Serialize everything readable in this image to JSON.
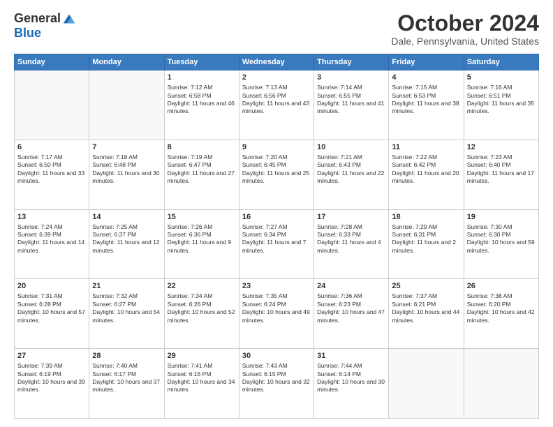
{
  "logo": {
    "general": "General",
    "blue": "Blue"
  },
  "title": "October 2024",
  "location": "Dale, Pennsylvania, United States",
  "days_of_week": [
    "Sunday",
    "Monday",
    "Tuesday",
    "Wednesday",
    "Thursday",
    "Friday",
    "Saturday"
  ],
  "weeks": [
    [
      {
        "day": "",
        "info": ""
      },
      {
        "day": "",
        "info": ""
      },
      {
        "day": "1",
        "info": "Sunrise: 7:12 AM\nSunset: 6:58 PM\nDaylight: 11 hours and 46 minutes."
      },
      {
        "day": "2",
        "info": "Sunrise: 7:13 AM\nSunset: 6:56 PM\nDaylight: 11 hours and 43 minutes."
      },
      {
        "day": "3",
        "info": "Sunrise: 7:14 AM\nSunset: 6:55 PM\nDaylight: 11 hours and 41 minutes."
      },
      {
        "day": "4",
        "info": "Sunrise: 7:15 AM\nSunset: 6:53 PM\nDaylight: 11 hours and 38 minutes."
      },
      {
        "day": "5",
        "info": "Sunrise: 7:16 AM\nSunset: 6:51 PM\nDaylight: 11 hours and 35 minutes."
      }
    ],
    [
      {
        "day": "6",
        "info": "Sunrise: 7:17 AM\nSunset: 6:50 PM\nDaylight: 11 hours and 33 minutes."
      },
      {
        "day": "7",
        "info": "Sunrise: 7:18 AM\nSunset: 6:48 PM\nDaylight: 11 hours and 30 minutes."
      },
      {
        "day": "8",
        "info": "Sunrise: 7:19 AM\nSunset: 6:47 PM\nDaylight: 11 hours and 27 minutes."
      },
      {
        "day": "9",
        "info": "Sunrise: 7:20 AM\nSunset: 6:45 PM\nDaylight: 11 hours and 25 minutes."
      },
      {
        "day": "10",
        "info": "Sunrise: 7:21 AM\nSunset: 6:43 PM\nDaylight: 11 hours and 22 minutes."
      },
      {
        "day": "11",
        "info": "Sunrise: 7:22 AM\nSunset: 6:42 PM\nDaylight: 11 hours and 20 minutes."
      },
      {
        "day": "12",
        "info": "Sunrise: 7:23 AM\nSunset: 6:40 PM\nDaylight: 11 hours and 17 minutes."
      }
    ],
    [
      {
        "day": "13",
        "info": "Sunrise: 7:24 AM\nSunset: 6:39 PM\nDaylight: 11 hours and 14 minutes."
      },
      {
        "day": "14",
        "info": "Sunrise: 7:25 AM\nSunset: 6:37 PM\nDaylight: 11 hours and 12 minutes."
      },
      {
        "day": "15",
        "info": "Sunrise: 7:26 AM\nSunset: 6:36 PM\nDaylight: 11 hours and 9 minutes."
      },
      {
        "day": "16",
        "info": "Sunrise: 7:27 AM\nSunset: 6:34 PM\nDaylight: 11 hours and 7 minutes."
      },
      {
        "day": "17",
        "info": "Sunrise: 7:28 AM\nSunset: 6:33 PM\nDaylight: 11 hours and 4 minutes."
      },
      {
        "day": "18",
        "info": "Sunrise: 7:29 AM\nSunset: 6:31 PM\nDaylight: 11 hours and 2 minutes."
      },
      {
        "day": "19",
        "info": "Sunrise: 7:30 AM\nSunset: 6:30 PM\nDaylight: 10 hours and 59 minutes."
      }
    ],
    [
      {
        "day": "20",
        "info": "Sunrise: 7:31 AM\nSunset: 6:28 PM\nDaylight: 10 hours and 57 minutes."
      },
      {
        "day": "21",
        "info": "Sunrise: 7:32 AM\nSunset: 6:27 PM\nDaylight: 10 hours and 54 minutes."
      },
      {
        "day": "22",
        "info": "Sunrise: 7:34 AM\nSunset: 6:26 PM\nDaylight: 10 hours and 52 minutes."
      },
      {
        "day": "23",
        "info": "Sunrise: 7:35 AM\nSunset: 6:24 PM\nDaylight: 10 hours and 49 minutes."
      },
      {
        "day": "24",
        "info": "Sunrise: 7:36 AM\nSunset: 6:23 PM\nDaylight: 10 hours and 47 minutes."
      },
      {
        "day": "25",
        "info": "Sunrise: 7:37 AM\nSunset: 6:21 PM\nDaylight: 10 hours and 44 minutes."
      },
      {
        "day": "26",
        "info": "Sunrise: 7:38 AM\nSunset: 6:20 PM\nDaylight: 10 hours and 42 minutes."
      }
    ],
    [
      {
        "day": "27",
        "info": "Sunrise: 7:39 AM\nSunset: 6:19 PM\nDaylight: 10 hours and 39 minutes."
      },
      {
        "day": "28",
        "info": "Sunrise: 7:40 AM\nSunset: 6:17 PM\nDaylight: 10 hours and 37 minutes."
      },
      {
        "day": "29",
        "info": "Sunrise: 7:41 AM\nSunset: 6:16 PM\nDaylight: 10 hours and 34 minutes."
      },
      {
        "day": "30",
        "info": "Sunrise: 7:43 AM\nSunset: 6:15 PM\nDaylight: 10 hours and 32 minutes."
      },
      {
        "day": "31",
        "info": "Sunrise: 7:44 AM\nSunset: 6:14 PM\nDaylight: 10 hours and 30 minutes."
      },
      {
        "day": "",
        "info": ""
      },
      {
        "day": "",
        "info": ""
      }
    ]
  ]
}
